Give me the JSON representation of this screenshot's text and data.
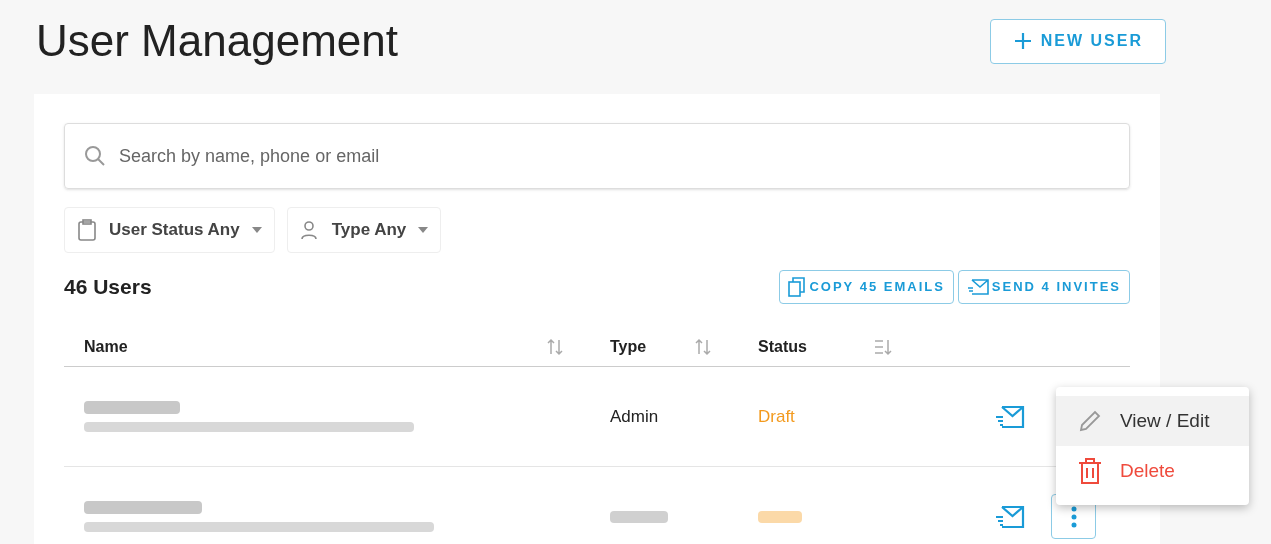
{
  "page_title": "User Management",
  "new_user_button": {
    "label": "NEW USER"
  },
  "search": {
    "placeholder": "Search by name, phone or email"
  },
  "filters": [
    {
      "label": "User Status Any",
      "kind": "status"
    },
    {
      "label": "Type Any",
      "kind": "type"
    }
  ],
  "user_count": "46 Users",
  "actions": [
    {
      "label": "COPY 45 EMAILS",
      "kind": "copy"
    },
    {
      "label": "SEND 4 INVITES",
      "kind": "send"
    }
  ],
  "table": {
    "columns": [
      {
        "label": "Name",
        "kind": "both"
      },
      {
        "label": "Type",
        "kind": "both"
      },
      {
        "label": "Status",
        "kind": "desc"
      }
    ],
    "rows": [
      {
        "kind": "partly_redacted",
        "type": "Admin",
        "status": "Draft"
      },
      {
        "kind": "redacted"
      }
    ]
  },
  "context_menu": {
    "items": [
      {
        "label": "View / Edit",
        "kind": "edit",
        "selected": true
      },
      {
        "label": "Delete",
        "kind": "delete",
        "selected": false
      }
    ]
  }
}
